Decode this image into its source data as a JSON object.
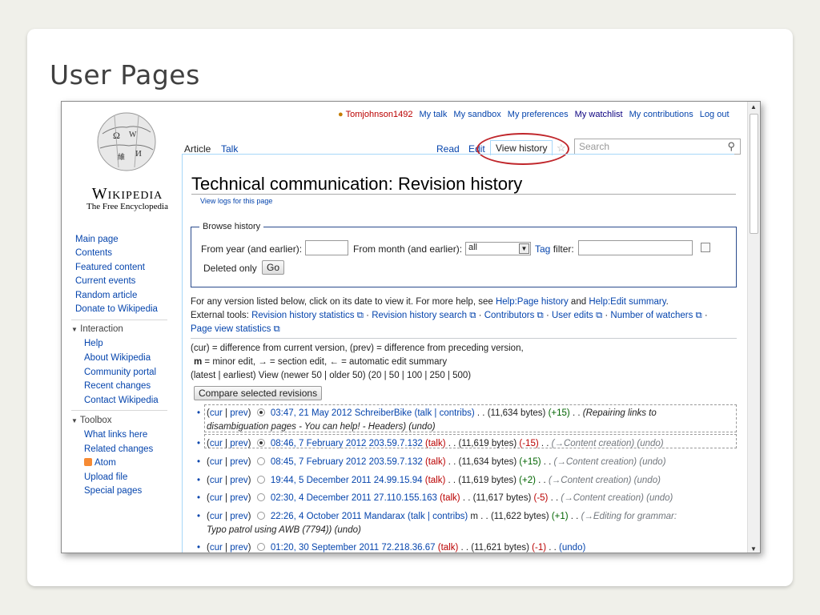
{
  "slide": {
    "title": "User Pages"
  },
  "logo": {
    "name": "Wikipedia",
    "tagline": "The Free Encyclopedia"
  },
  "userbar": {
    "username": "Tomjohnson1492",
    "links": [
      "My talk",
      "My sandbox",
      "My preferences",
      "My watchlist",
      "My contributions",
      "Log out"
    ]
  },
  "tabs": {
    "left": [
      "Article",
      "Talk"
    ],
    "right": [
      "Read",
      "Edit",
      "View history"
    ],
    "search_placeholder": "Search"
  },
  "sidebar": {
    "nav": [
      "Main page",
      "Contents",
      "Featured content",
      "Current events",
      "Random article",
      "Donate to Wikipedia"
    ],
    "interaction_header": "Interaction",
    "interaction": [
      "Help",
      "About Wikipedia",
      "Community portal",
      "Recent changes",
      "Contact Wikipedia"
    ],
    "toolbox_header": "Toolbox",
    "toolbox": [
      "What links here",
      "Related changes",
      "Atom",
      "Upload file",
      "Special pages"
    ]
  },
  "page": {
    "title": "Technical communication: Revision history",
    "view_logs": "View logs for this page"
  },
  "browse": {
    "legend": "Browse history",
    "year_label": "From year (and earlier):",
    "month_label": "From month (and earlier):",
    "month_value": "all",
    "tag_label": "Tag",
    "filter_label": "filter:",
    "deleted_only": "Deleted only",
    "go": "Go"
  },
  "help": {
    "line1_prefix": "For any version listed below, click on its date to view it. For more help, see ",
    "line1_link1": "Help:Page history",
    "line1_and": " and ",
    "line1_link2": "Help:Edit summary",
    "line1_end": ".",
    "tools_label": "External tools:",
    "tools": [
      "Revision history statistics",
      "Revision history search",
      "Contributors",
      "User edits",
      "Number of watchers",
      "Page view statistics"
    ],
    "legend1": "(cur) = difference from current version, (prev) = difference from preceding version,",
    "legend2_m": "m",
    "legend2_rest": " = minor edit, → = section edit, ← = automatic edit summary",
    "nav_line": "(latest | earliest) View (newer 50 | older 50) (20 | 50 | 100 | 250 | 500)",
    "compare": "Compare selected revisions"
  },
  "revisions": [
    {
      "date": "03:47, 21 May 2012",
      "user": "SchreiberBike",
      "userlinks": "(talk | contribs)",
      "size": "(11,634 bytes)",
      "change": "(+15)",
      "summary": "(Repairing links to",
      "summary2": "disambiguation pages - You can help! - Headers) (undo)"
    },
    {
      "date": "08:46, 7 February 2012",
      "user": "203.59.7.132",
      "userlinks": "(talk)",
      "size": "(11,619 bytes)",
      "change": "(-15)",
      "summary": "(→Content creation) (undo)"
    },
    {
      "date": "08:45, 7 February 2012",
      "user": "203.59.7.132",
      "userlinks": "(talk)",
      "size": "(11,634 bytes)",
      "change": "(+15)",
      "summary": "(→Content creation) (undo)"
    },
    {
      "date": "19:44, 5 December 2011",
      "user": "24.99.15.94",
      "userlinks": "(talk)",
      "size": "(11,619 bytes)",
      "change": "(+2)",
      "summary": "(→Content creation) (undo)"
    },
    {
      "date": "02:30, 4 December 2011",
      "user": "27.110.155.163",
      "userlinks": "(talk)",
      "size": "(11,617 bytes)",
      "change": "(-5)",
      "summary": "(→Content creation) (undo)"
    },
    {
      "date": "22:26, 4 October 2011",
      "user": "Mandarax",
      "userlinks": "(talk | contribs)",
      "size": "m . . (11,622 bytes)",
      "change": "(+1)",
      "summary": "(→Editing for grammar:",
      "summary2": "Typo patrol using AWB (7794)) (undo)"
    },
    {
      "date": "01:20, 30 September 2011",
      "user": "72.218.36.67",
      "userlinks": "(talk)",
      "size": "(11,621 bytes)",
      "change": "(-1)",
      "summary": "(undo)"
    }
  ],
  "colors": {
    "link": "#0645ad",
    "highlight_ellipse": "#c0262b",
    "removed": "#ba0000",
    "added": "#006400"
  }
}
